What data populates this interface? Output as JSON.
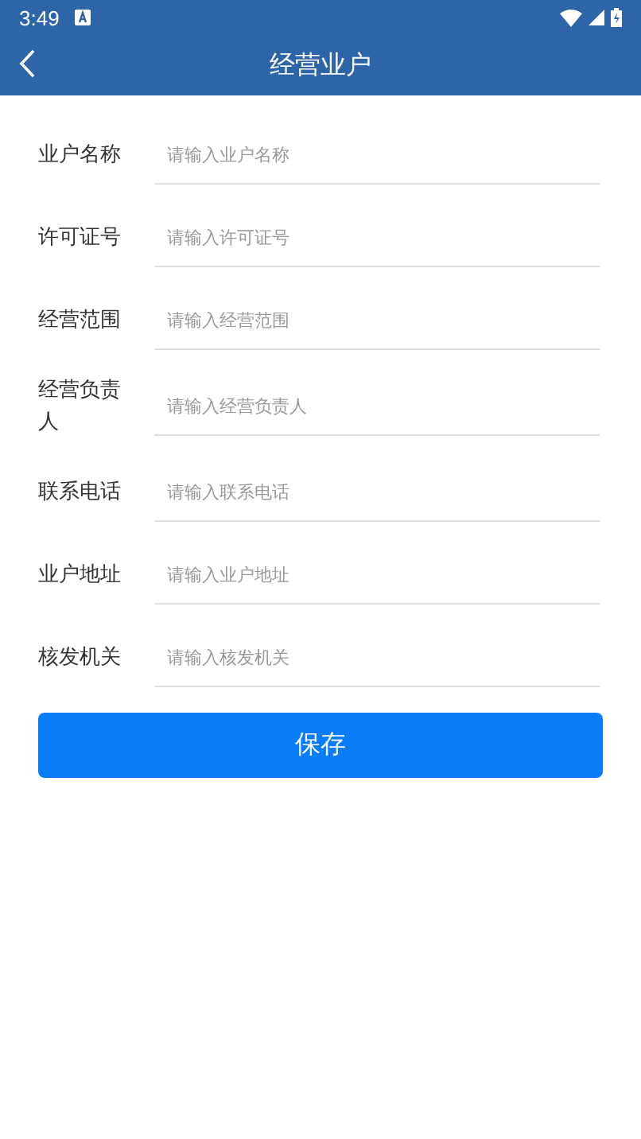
{
  "status_bar": {
    "time": "3:49"
  },
  "header": {
    "title": "经营业户"
  },
  "fields": [
    {
      "label": "业户名称",
      "placeholder": "请输入业户名称"
    },
    {
      "label": "许可证号",
      "placeholder": "请输入许可证号"
    },
    {
      "label": "经营范围",
      "placeholder": "请输入经营范围"
    },
    {
      "label": "经营负责人",
      "placeholder": "请输入经营负责人"
    },
    {
      "label": "联系电话",
      "placeholder": "请输入联系电话"
    },
    {
      "label": "业户地址",
      "placeholder": "请输入业户地址"
    },
    {
      "label": "核发机关",
      "placeholder": "请输入核发机关"
    }
  ],
  "save_button": "保存"
}
